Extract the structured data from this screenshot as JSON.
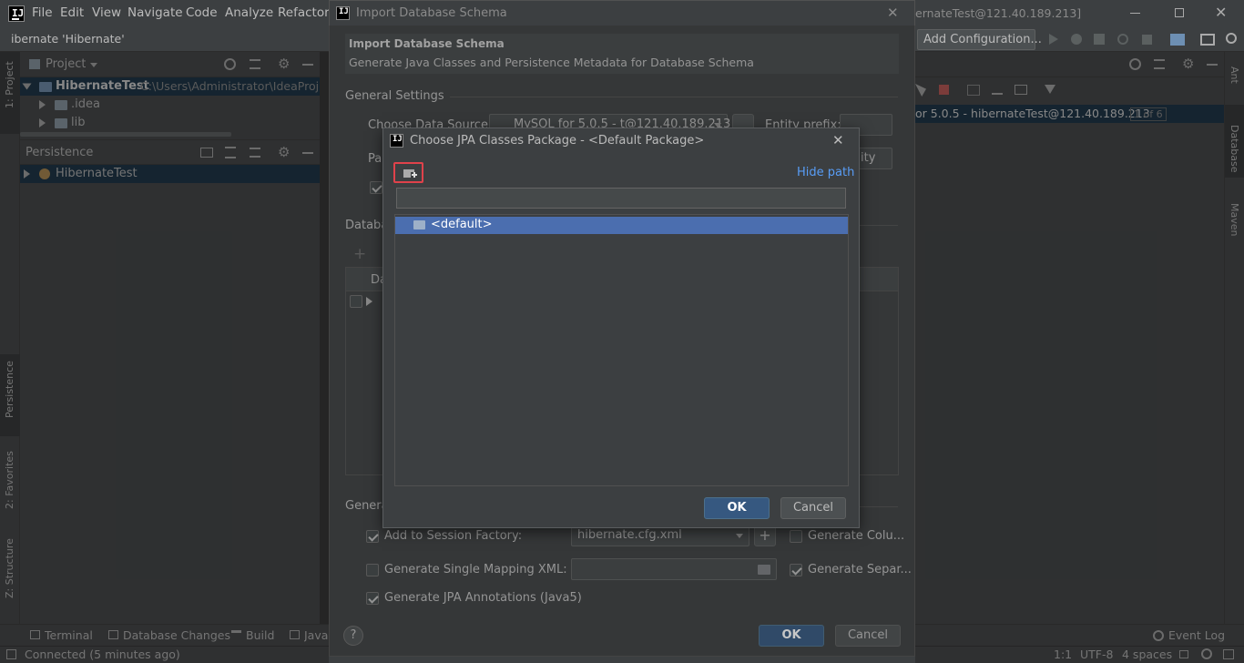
{
  "menubar": {
    "items": [
      "File",
      "Edit",
      "View",
      "Navigate",
      "Code",
      "Analyze",
      "Refactor"
    ],
    "window_title_fragment": "ernateTest@121.40.189.213]"
  },
  "navbar": {
    "breadcrumb": "ibernate 'Hibernate'",
    "add_configuration": "Add Configuration..."
  },
  "project_panel": {
    "title": "Project",
    "root_label": "HibernateTest",
    "root_path": "C:\\Users\\Administrator\\IdeaProjec",
    "children": [
      ".idea",
      "lib"
    ],
    "persistence_title": "Persistence",
    "persistence_root": "HibernateTest"
  },
  "left_stripe": {
    "tabs": [
      "1: Project",
      "Persistence",
      "2: Favorites",
      "Z: Structure"
    ]
  },
  "right_stripe": {
    "tabs": [
      "Ant",
      "Database",
      "Maven"
    ]
  },
  "db_panel": {
    "datasource": "or 5.0.5 - hibernateTest@121.40.189.213",
    "count_badge": "1 of 6"
  },
  "import_dialog": {
    "title": "Import Database Schema",
    "header_title": "Import Database Schema",
    "header_subtitle": "Generate Java Classes and Persistence Metadata for Database Schema",
    "general_settings": "General Settings",
    "choose_datasource_label": "Choose Data Source:",
    "datasource_value": "MySQL for 5.0.5 - t@121.40.189.213",
    "entity_prefix_label": "Entity prefix:",
    "package_label_fragment": "Pac",
    "entity_suffix_fragment": "ity",
    "database_schema_label_fragment": "Databa",
    "table_header_fragment": "Da",
    "generation_label_fragment": "Genera",
    "add_session_factory": "Add to Session Factory:",
    "session_factory_value": "hibernate.cfg.xml",
    "generate_columns": "Generate Colu...",
    "generate_single_mapping": "Generate Single Mapping XML:",
    "generate_separate": "Generate Separ...",
    "generate_jpa_annotations": "Generate JPA Annotations (Java5)",
    "ok": "OK",
    "cancel": "Cancel",
    "help": "?"
  },
  "package_dialog": {
    "title": "Choose JPA Classes Package - <Default Package>",
    "hide_path": "Hide path",
    "path_value": "",
    "tree_items": [
      "<default>"
    ],
    "ok": "OK",
    "cancel": "Cancel"
  },
  "bottom_tools": {
    "items": [
      "Terminal",
      "Database Changes",
      "Build",
      "Java"
    ],
    "event_log": "Event Log"
  },
  "status_bar": {
    "message": "Connected (5 minutes ago)",
    "position": "1:1",
    "encoding": "UTF-8",
    "indent": "4 spaces"
  },
  "colors": {
    "accent": "#365880",
    "selection": "#4b6eaf",
    "link": "#589df6",
    "highlight_box": "#e0424b"
  }
}
